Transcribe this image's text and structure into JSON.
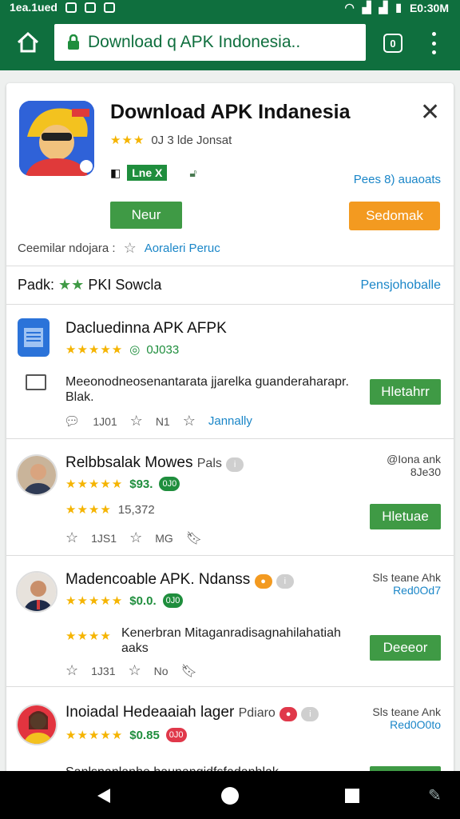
{
  "status_bar": {
    "left_text": "1ea.1ued",
    "right_text": "E0:30M"
  },
  "browser": {
    "url": "Download q APK Indonesia..",
    "tab_count": "0"
  },
  "app": {
    "title": "Download APK Indanesia",
    "stars": "★★★",
    "rating_text": "0J 3 lde Jonsat",
    "badge_label": "Lne X",
    "dev_link": "Pees 8) auaoats",
    "install_label": "Neur",
    "download_label": "Sedomak",
    "similar_label": "Ceemilar ndojara :",
    "similar_link": "Aoraleri Peruc",
    "rank_label": "Padk:",
    "rank_stars": "★★",
    "rank_text": "PKI Sowcla",
    "rank_link": "Pensjohoballe"
  },
  "items": [
    {
      "title": "Dacluedinna APK AFPK",
      "stars": "★★★★★",
      "sub": "0J033",
      "desc": "Meeonodneosenantarata jjarelka guanderaharapr. Blak.",
      "button": "Hletahrr",
      "meta1": "1J01",
      "meta2": "N1",
      "meta_link": "Jannally"
    },
    {
      "title": "Relbbsalak Mowes",
      "title_suffix": "Pals",
      "stars": "★★★★★",
      "price": "$93.",
      "chip": "0J0",
      "stars2": "★★★★",
      "count": "15,372",
      "button": "Hletuae",
      "side1": "@Iona ank",
      "side2": "8Je30",
      "meta1": "1JS1",
      "meta2": "MG"
    },
    {
      "title": "Madencoable APK. Ndanss",
      "stars": "★★★★★",
      "price": "$0.0.",
      "chip": "0J0",
      "stars2": "★★★★",
      "desc": "Kenerbran Mitaganradisagnahilahatiah aaks",
      "button": "Deeeor",
      "side1": "Sls teane Ahk",
      "side2": "Red0Od7",
      "meta1": "1J31",
      "meta2": "No"
    },
    {
      "title": "Inoiadal Hedeaaiah lager",
      "title_suffix": "Pdiaro",
      "stars": "★★★★★",
      "price": "$0.85",
      "chip": "0J0",
      "side1": "Sls teane Ank",
      "side2": "Red0O0to",
      "desc": "Sanlsnanlanhe baunangidfsfadanhlak"
    }
  ]
}
